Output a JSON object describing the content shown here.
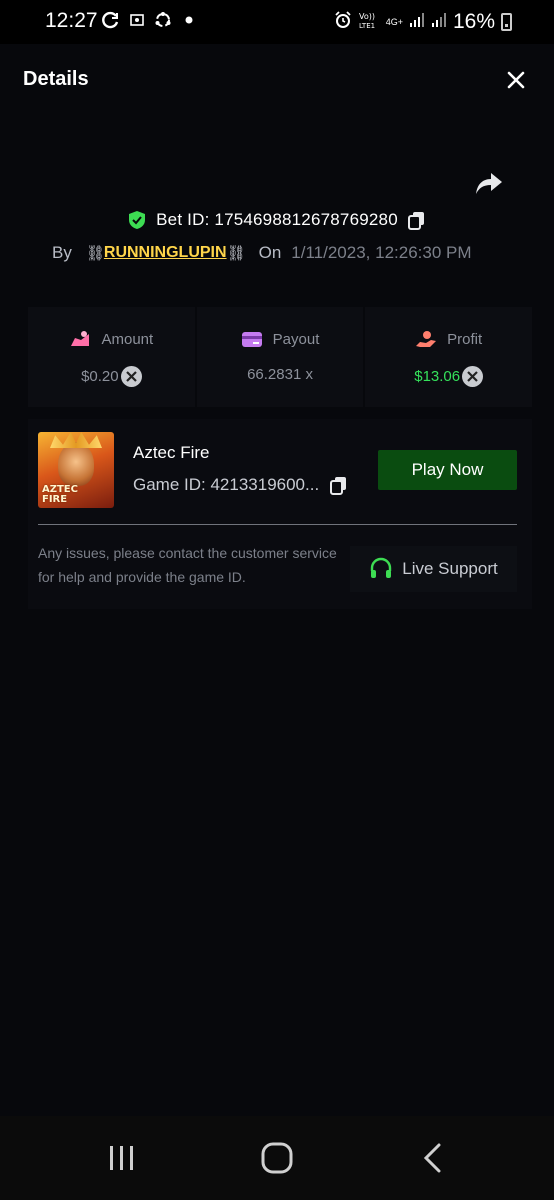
{
  "status_bar": {
    "time": "12:27",
    "battery": "16%",
    "network": "4G+"
  },
  "header": {
    "title": "Details"
  },
  "bet": {
    "bet_id_label": "Bet ID: 1754698812678769280",
    "by_label": "By",
    "chain_left": "⛓",
    "username": "RUNNINGLUPIN",
    "chain_right": "⛓",
    "on_label": "On",
    "datetime": "1/11/2023, 12:26:30 PM"
  },
  "stats": {
    "amount": {
      "label": "Amount",
      "value": "$0.20"
    },
    "payout": {
      "label": "Payout",
      "value": "66.2831 x"
    },
    "profit": {
      "label": "Profit",
      "value": "$13.06"
    }
  },
  "game": {
    "name": "Aztec Fire",
    "game_id": "Game ID: 4213319600...",
    "thumb_text_1": "AZTEC",
    "thumb_text_2": "FIRE",
    "play_label": "Play Now",
    "help_text": "Any issues, please contact the customer service for help and provide the game ID.",
    "support_label": "Live Support"
  },
  "colors": {
    "accent_green": "#0a4c10",
    "profit_green": "#35e15b",
    "username_yellow": "#ffd54a",
    "shield_green": "#3ddc53"
  },
  "icons": {
    "status_left": [
      "refresh-icon",
      "photo-icon",
      "sync-icon",
      "dot-icon"
    ],
    "status_right": [
      "alarm-icon",
      "volte-icon",
      "signal-icon",
      "signal-icon",
      "battery-icon"
    ],
    "nav": [
      "recents-icon",
      "home-icon",
      "back-icon"
    ]
  }
}
